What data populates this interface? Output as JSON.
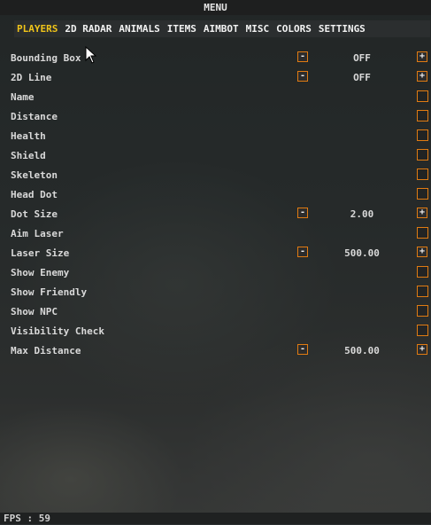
{
  "window": {
    "title": "MENU"
  },
  "tabs": [
    {
      "label": "PLAYERS",
      "active": true
    },
    {
      "label": "2D RADAR",
      "active": false
    },
    {
      "label": "ANIMALS",
      "active": false
    },
    {
      "label": "ITEMS",
      "active": false
    },
    {
      "label": "AIMBOT",
      "active": false
    },
    {
      "label": "MISC",
      "active": false
    },
    {
      "label": "COLORS",
      "active": false
    },
    {
      "label": "SETTINGS",
      "active": false
    }
  ],
  "rows": [
    {
      "label": "Bounding Box",
      "type": "stepper",
      "value": "OFF"
    },
    {
      "label": "2D Line",
      "type": "stepper",
      "value": "OFF"
    },
    {
      "label": "Name",
      "type": "checkbox"
    },
    {
      "label": "Distance",
      "type": "checkbox"
    },
    {
      "label": "Health",
      "type": "checkbox"
    },
    {
      "label": "Shield",
      "type": "checkbox"
    },
    {
      "label": "Skeleton",
      "type": "checkbox"
    },
    {
      "label": "Head Dot",
      "type": "checkbox"
    },
    {
      "label": "Dot Size",
      "type": "stepper",
      "value": "2.00"
    },
    {
      "label": "Aim Laser",
      "type": "checkbox"
    },
    {
      "label": "Laser Size",
      "type": "stepper",
      "value": "500.00"
    },
    {
      "label": "Show Enemy",
      "type": "checkbox"
    },
    {
      "label": "Show Friendly",
      "type": "checkbox"
    },
    {
      "label": "Show NPC",
      "type": "checkbox"
    },
    {
      "label": "Visibility Check",
      "type": "checkbox"
    },
    {
      "label": "Max Distance",
      "type": "stepper",
      "value": "500.00"
    }
  ],
  "stepper": {
    "minus_label": "-",
    "plus_label": "+"
  },
  "footer": {
    "fps_text": "FPS : 59"
  },
  "colors": {
    "accent": "#e07b12",
    "active_tab": "#f0c419",
    "text": "#d9d9d9"
  }
}
